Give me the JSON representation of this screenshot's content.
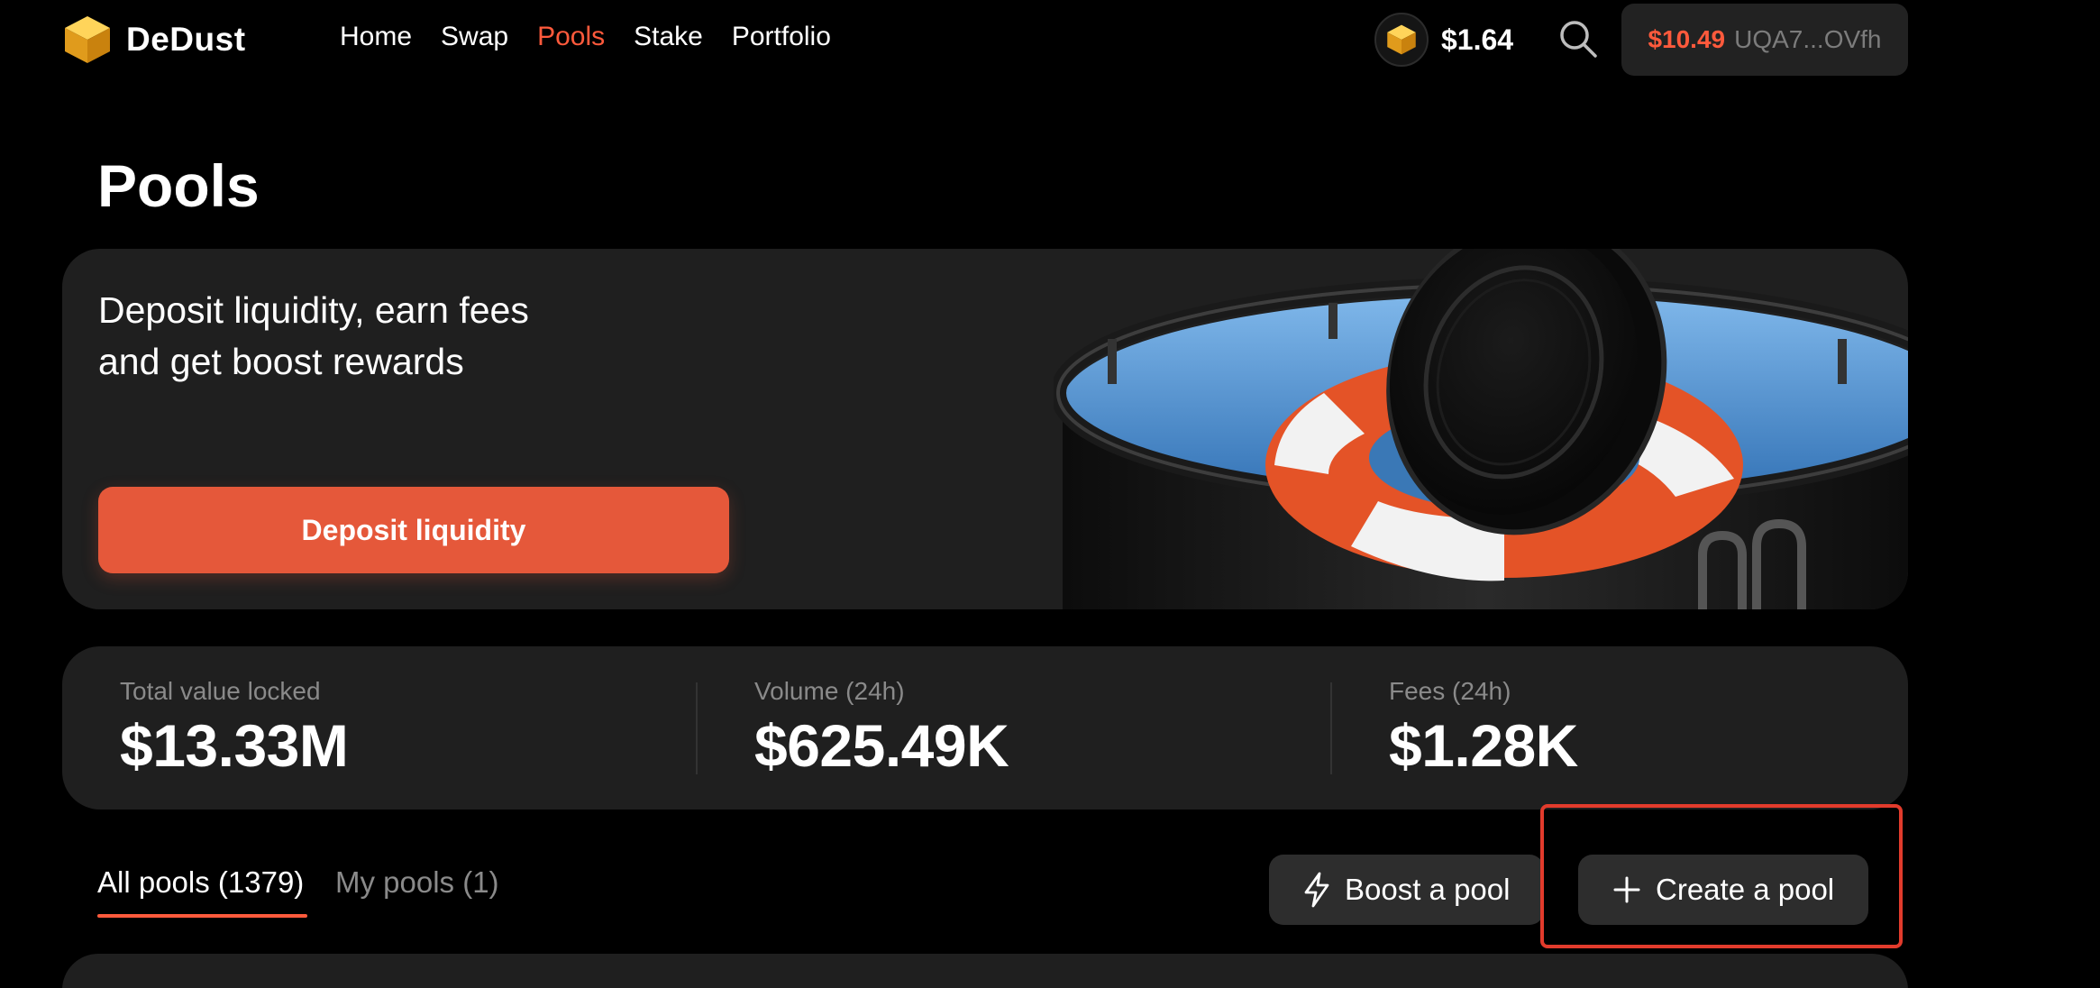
{
  "nav": {
    "logo_text": "DeDust",
    "links": [
      "Home",
      "Swap",
      "Pools",
      "Stake",
      "Portfolio"
    ],
    "active_link": "Pools",
    "token_price": "$1.64",
    "wallet_balance": "$10.49",
    "wallet_address": "UQA7...OVfh"
  },
  "page": {
    "title": "Pools"
  },
  "hero": {
    "headline_line1": "Deposit liquidity, earn fees",
    "headline_line2": "and get boost rewards",
    "button_label": "Deposit liquidity"
  },
  "stats": [
    {
      "label": "Total value locked",
      "value": "$13.33M"
    },
    {
      "label": "Volume (24h)",
      "value": "$625.49K"
    },
    {
      "label": "Fees (24h)",
      "value": "$1.28K"
    }
  ],
  "tabs": [
    {
      "label": "All pools (1379)",
      "active": true
    },
    {
      "label": "My pools (1)",
      "active": false
    }
  ],
  "actions": {
    "boost_label": "Boost a pool",
    "create_label": "Create a pool"
  },
  "colors": {
    "accent": "#ff5a3c",
    "button": "#e5583a",
    "card": "#1f1f1f",
    "highlight": "#e23b2c"
  },
  "icons": {
    "logo": "cube-icon",
    "token": "cube-icon",
    "search": "search-icon",
    "boost": "lightning-icon",
    "create": "plus-icon"
  }
}
